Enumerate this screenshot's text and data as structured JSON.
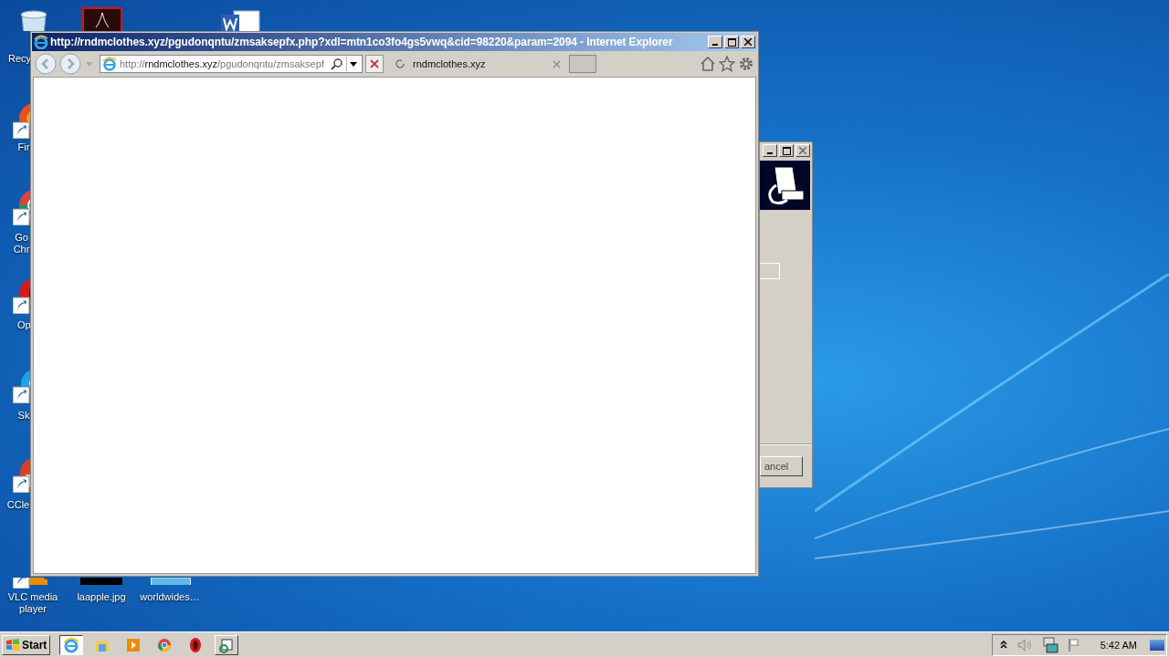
{
  "desktop": {
    "icons": [
      {
        "kind": "recycle-bin",
        "label": "Recy"
      },
      {
        "kind": "acrobat"
      },
      {
        "kind": "word"
      },
      {
        "kind": "firefox",
        "label": "Fir"
      },
      {
        "kind": "chrome",
        "label": "Go Chr"
      },
      {
        "kind": "opera",
        "label": "Op"
      },
      {
        "kind": "skype",
        "label": "Sk"
      },
      {
        "kind": "ccleaner",
        "label": "CCle"
      },
      {
        "kind": "vlc",
        "label": "VLC media player"
      },
      {
        "kind": "image-dark",
        "label": "laapple.jpg"
      },
      {
        "kind": "image-file",
        "label": "worldwides…"
      }
    ]
  },
  "dialog": {
    "button": "ancel"
  },
  "browser": {
    "title": "http://rndmclothes.xyz/pgudonqntu/zmsaksepfx.php?xdl=mtn1co3fo4gs5vwq&cid=98220&param=2094 - Internet Explorer",
    "address": {
      "scheme": "http://",
      "host": "rndmclothes.xyz",
      "path": "/pgudonqntu/zmsaksepf"
    },
    "tab": {
      "label": "rndmclothes.xyz"
    }
  },
  "taskbar": {
    "start": "Start",
    "items": [
      {
        "kind": "ie",
        "selected": true
      },
      {
        "kind": "explorer",
        "selected": false
      },
      {
        "kind": "media",
        "selected": false
      },
      {
        "kind": "chrome",
        "selected": false
      },
      {
        "kind": "opera",
        "selected": false
      },
      {
        "kind": "app",
        "selected": false
      }
    ],
    "clock": "5:42 AM"
  }
}
